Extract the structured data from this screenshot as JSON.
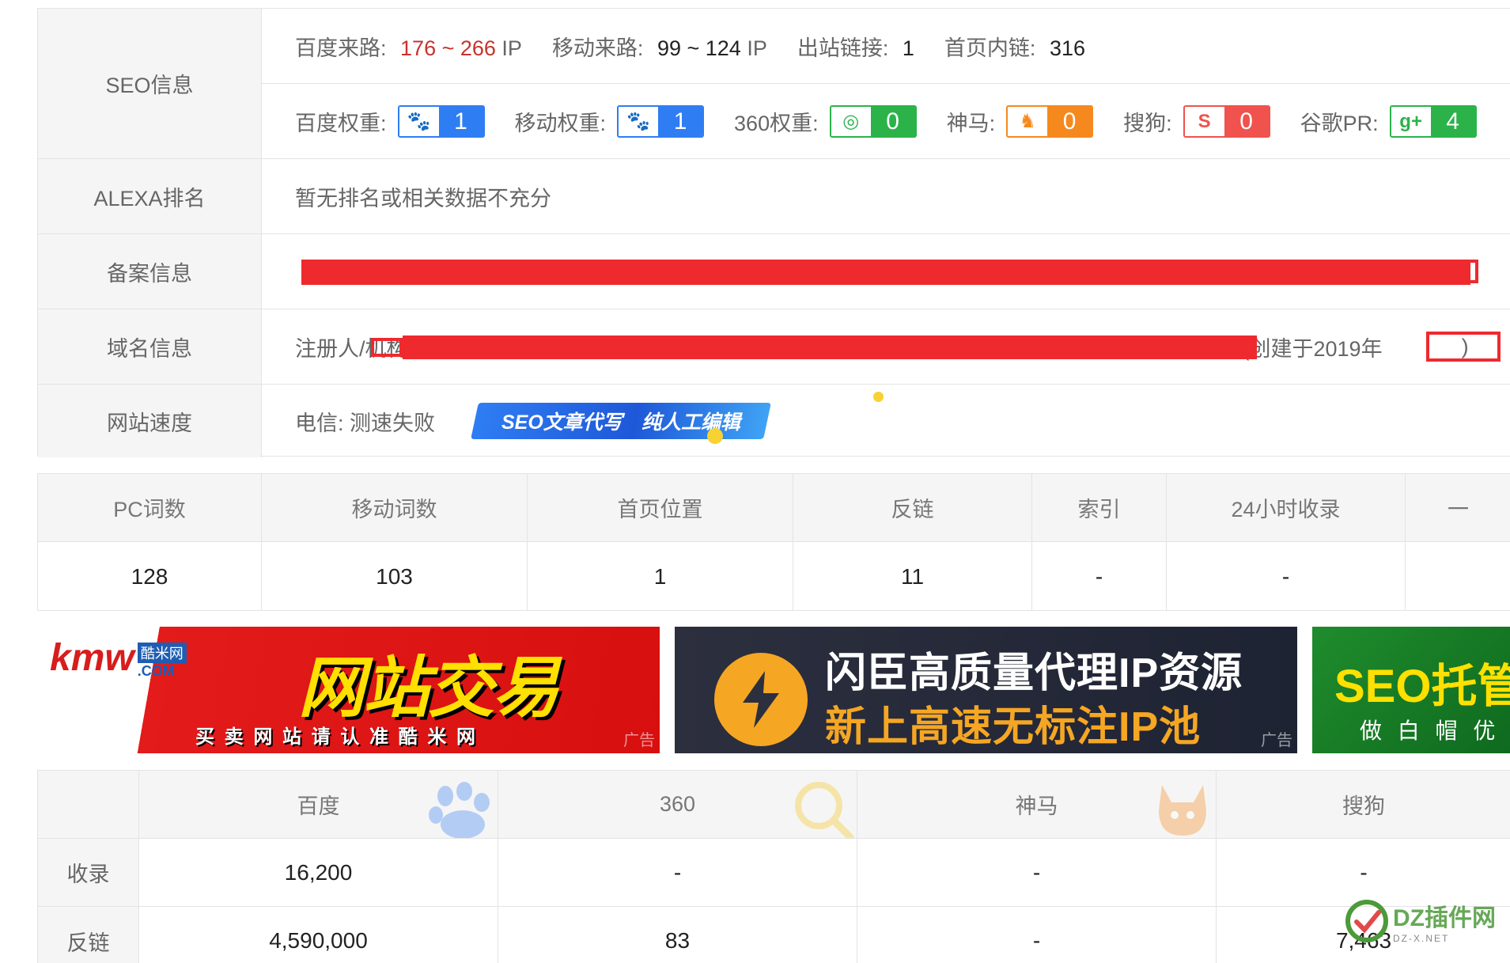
{
  "seo_info": {
    "label": "SEO信息",
    "traffic": {
      "baidu_label": "百度来路:",
      "baidu_value": "176 ~ 266",
      "baidu_unit": "IP",
      "mobile_label": "移动来路:",
      "mobile_value": "99 ~ 124",
      "mobile_unit": "IP",
      "outbound_label": "出站链接:",
      "outbound_value": "1",
      "internal_label": "首页内链:",
      "internal_value": "316"
    },
    "weights": [
      {
        "label": "百度权重:",
        "value": "1",
        "icon": "baidu-paw-icon",
        "color": "#2f7df3"
      },
      {
        "label": "移动权重:",
        "value": "1",
        "icon": "mobile-paw-icon",
        "color": "#2f7df3"
      },
      {
        "label": "360权重:",
        "value": "0",
        "icon": "360-icon",
        "color": "#2bb34a"
      },
      {
        "label": "神马:",
        "value": "0",
        "icon": "shenma-icon",
        "color": "#f5891d"
      },
      {
        "label": "搜狗:",
        "value": "0",
        "icon": "sogou-icon",
        "color": "#f0524d"
      },
      {
        "label": "谷歌PR:",
        "value": "4",
        "icon": "google-plus-icon",
        "color": "#2bb34a"
      }
    ]
  },
  "alexa": {
    "label": "ALEXA排名",
    "value": "暂无排名或相关数据不充分"
  },
  "beian": {
    "label": "备案信息"
  },
  "domain": {
    "label": "域名信息",
    "prefix": "注册人/机构",
    "created": "(创建于2019年",
    "suffix": ")"
  },
  "speed": {
    "label": "网站速度",
    "value": "电信: 测速失败",
    "ad_left": "SEO文章代写",
    "ad_right": "纯人工编辑"
  },
  "stats": {
    "headers": [
      "PC词数",
      "移动词数",
      "首页位置",
      "反链",
      "索引",
      "24小时收录",
      "一"
    ],
    "values": [
      "128",
      "103",
      "1",
      "11",
      "-",
      "-",
      ""
    ]
  },
  "ads": {
    "kmw_logo": "kmw",
    "kmw_logo_sub": "酷米网",
    "kmw_logo_com": ".COM",
    "kmw_title": "网站交易",
    "kmw_sub": "买 卖 网 站 请 认 准 酷 米 网",
    "ip_line1": "闪臣高质量代理IP资源",
    "ip_line2": "新上高速无标注IP池",
    "seo_title": "SEO托管",
    "seo_sub": "做 白 帽 优",
    "tag": "广告"
  },
  "engines": {
    "headers": [
      "百度",
      "360",
      "神马",
      "搜狗"
    ],
    "rows": [
      {
        "label": "收录",
        "values": [
          "16,200",
          "-",
          "-",
          "-"
        ]
      },
      {
        "label": "反链",
        "values": [
          "4,590,000",
          "83",
          "-",
          "7,463"
        ]
      }
    ]
  },
  "watermark": {
    "text": "DZ插件网",
    "sub": "DZ-X.NET"
  }
}
